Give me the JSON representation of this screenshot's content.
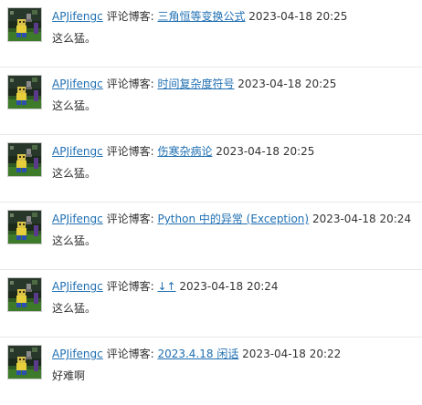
{
  "comments": [
    {
      "author": "APJifengc",
      "label": "评论博客:",
      "post_title": "三角恒等变换公式",
      "time": "2023-04-18 20:25",
      "content": "这么猛。"
    },
    {
      "author": "APJifengc",
      "label": "评论博客:",
      "post_title": "时间复杂度符号",
      "time": "2023-04-18 20:25",
      "content": "这么猛。"
    },
    {
      "author": "APJifengc",
      "label": "评论博客:",
      "post_title": "伤寒杂病论",
      "time": "2023-04-18 20:25",
      "content": "这么猛。"
    },
    {
      "author": "APJifengc",
      "label": "评论博客:",
      "post_title": "Python 中的异常 (Exception)",
      "time": "2023-04-18 20:24",
      "content": "这么猛。"
    },
    {
      "author": "APJifengc",
      "label": "评论博客:",
      "post_title": "↓↑",
      "time": "2023-04-18 20:24",
      "content": "这么猛。"
    },
    {
      "author": "APJifengc",
      "label": "评论博客:",
      "post_title": "2023.4.18 闲话",
      "time": "2023-04-18 20:22",
      "content": "好难啊"
    }
  ],
  "colors": {
    "link": "#1f6fb2",
    "text": "#333333",
    "divider": "#e8e8e8"
  },
  "icons": {
    "avatar": "minecraft-character-avatar"
  }
}
